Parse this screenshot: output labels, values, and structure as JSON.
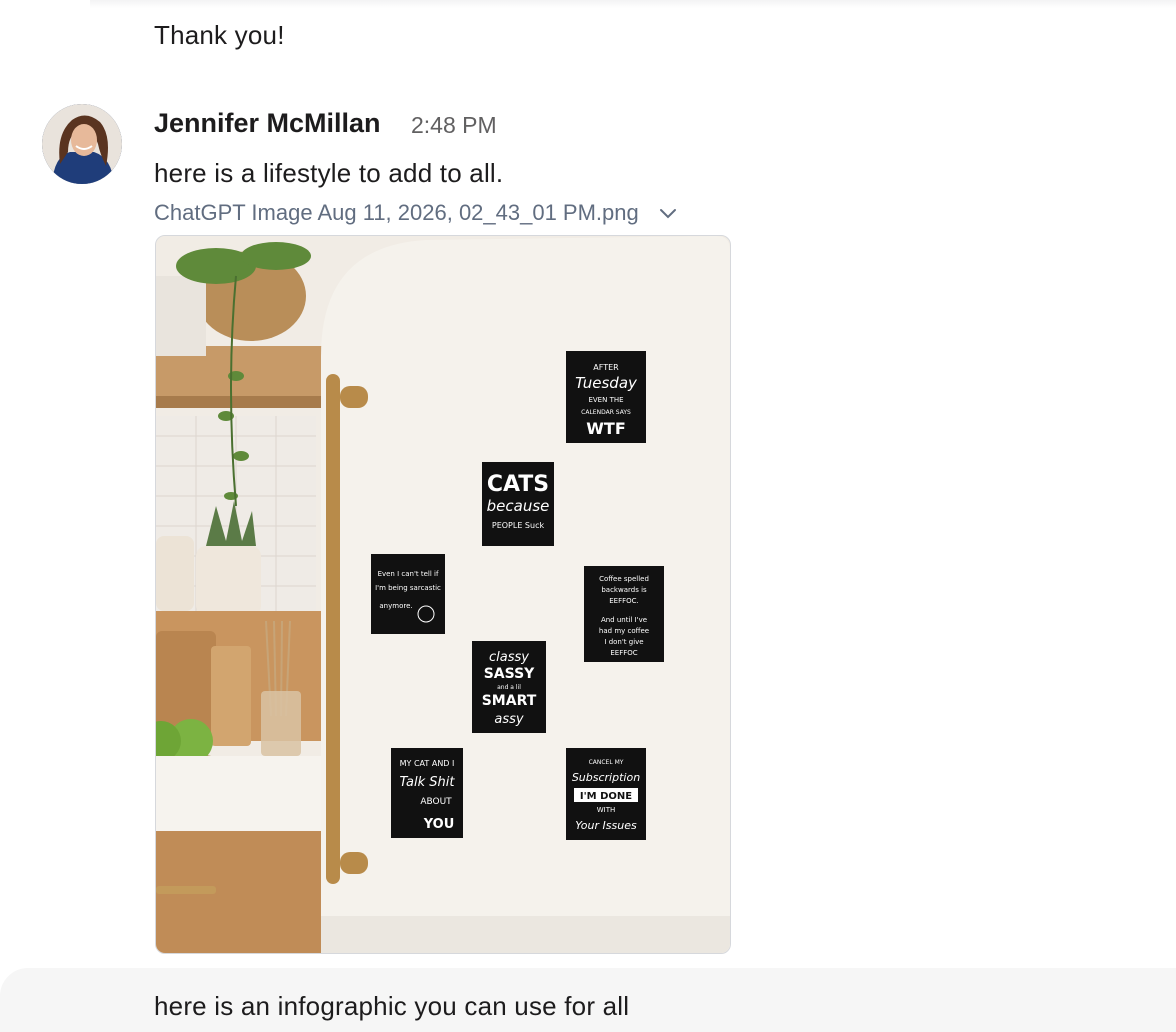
{
  "previous_message": {
    "text": "Thank you!"
  },
  "message": {
    "sender": "Jennifer McMillan",
    "time": "2:48 PM",
    "text": "here is a lifestyle to add to all.",
    "attachment": {
      "filename": "ChatGPT Image Aug 11, 2026, 02_43_01 PM.png",
      "magnets": {
        "tuesday": [
          "AFTER",
          "Tuesday",
          "EVEN THE",
          "CALENDAR SAYS",
          "WTF"
        ],
        "cats": [
          "CATS",
          "because",
          "PEOPLE Suck"
        ],
        "sarcastic": [
          "Even I can't tell if",
          "I'm being sarcastic",
          "anymore."
        ],
        "coffee": [
          "Coffee spelled",
          "backwards is",
          "EEFFOC.",
          "And until I've",
          "had my coffee",
          "I don't give",
          "EEFFOC"
        ],
        "sassy": [
          "classy",
          "SASSY",
          "and a lil",
          "SMART",
          "assy"
        ],
        "mycat": [
          "MY CAT AND I",
          "Talk Shit",
          "ABOUT",
          "YOU"
        ],
        "subscription": [
          "CANCEL MY",
          "Subscription",
          "I'M DONE",
          "WITH",
          "Your Issues"
        ]
      }
    }
  },
  "next_message": {
    "text": "here is an infographic you can use for all"
  },
  "icons": {
    "dropdown": "chevron-down-icon",
    "avatar": "user-avatar-photo"
  }
}
